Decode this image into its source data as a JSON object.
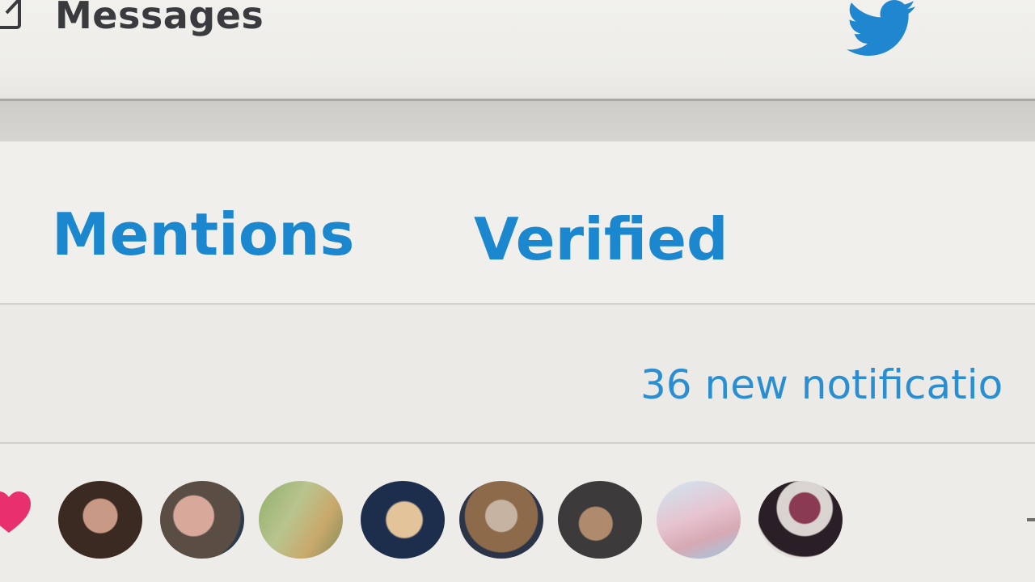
{
  "header": {
    "messages_label": "Messages",
    "compose_icon": "compose-icon",
    "logo_icon": "twitter-bird-icon"
  },
  "tabs": [
    {
      "label": "Mentions"
    },
    {
      "label": "Verified"
    }
  ],
  "notifications": {
    "banner_text": "36 new notificatio"
  },
  "avatar_row": {
    "leading_icon": "heart-icon",
    "avatar_count": 8
  },
  "colors": {
    "accent_blue": "#1b87cf",
    "link_blue": "#2a8fd2",
    "heart_pink": "#e8306f",
    "header_text": "#3a3b3e"
  }
}
